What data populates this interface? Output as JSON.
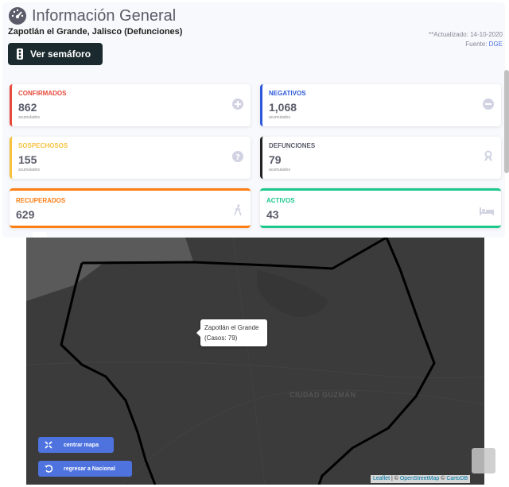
{
  "header": {
    "title": "Información General",
    "subtitle": "Zapotlán el Grande, Jalisco (Defunciones)",
    "updated": "**Actualizado: 14-10-2020",
    "source_label": "Fuente: ",
    "source_link": "DGE",
    "semaforo_label": "Ver semáforo"
  },
  "cards": {
    "confirmados": {
      "label": "CONFIRMADOS",
      "value": "862",
      "sub": "acumulados",
      "color": "#e74a3b",
      "icon": "plus-circle-icon"
    },
    "negativos": {
      "label": "NEGATIVOS",
      "value": "1,068",
      "sub": "acumulados",
      "color": "#2e59d9",
      "icon": "minus-circle-icon"
    },
    "sospechosos": {
      "label": "SOSPECHOSOS",
      "value": "155",
      "sub": "acumulados",
      "color": "#f6c23e",
      "icon": "question-circle-icon"
    },
    "defunciones": {
      "label": "DEFUNCIONES",
      "value": "79",
      "sub": "acumulados",
      "color": "#222222",
      "icon": "ribbon-icon"
    },
    "recuperados": {
      "label": "RECUPERADOS",
      "value": "629",
      "color": "#fd7e14",
      "icon": "walking-icon"
    },
    "activos": {
      "label": "ACTIVOS",
      "value": "43",
      "color": "#1cc88a",
      "icon": "bed-icon"
    }
  },
  "map": {
    "tooltip_line1": "Zapotlán el Grande",
    "tooltip_line2": "(Casos: 79)",
    "city_label": "CIUDAD GUZMÁN",
    "btn_center": "centrar mapa",
    "btn_back": "regresar a Nacional",
    "attrib_leaflet": "Leaflet",
    "attrib_mid": " | © ",
    "attrib_osm": "OpenStreetMap",
    "attrib_and": " © ",
    "attrib_carto": "CartoDB"
  }
}
